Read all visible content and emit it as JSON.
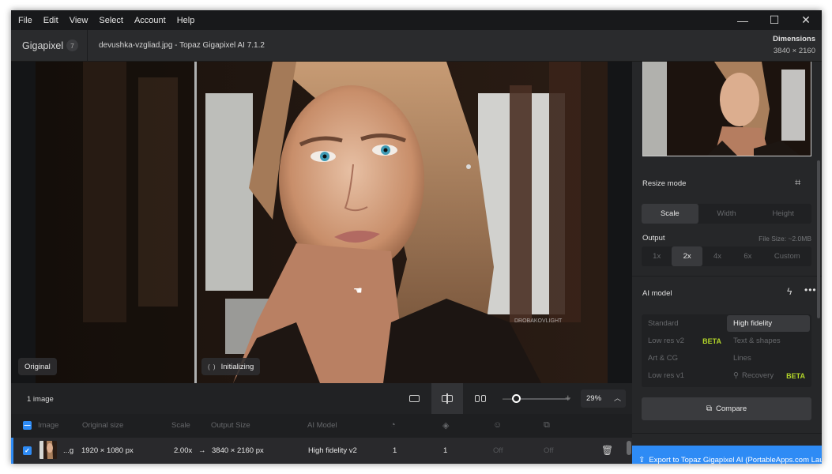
{
  "menu": [
    "File",
    "Edit",
    "View",
    "Select",
    "Account",
    "Help"
  ],
  "window_controls": {
    "minimize": "—",
    "maximize": "☐",
    "close": "✕"
  },
  "header": {
    "app_name": "Gigapixel",
    "app_count": "7",
    "doc_title": "devushka-vzgliad.jpg - Topaz Gigapixel AI 7.1.2",
    "dimensions_label": "Dimensions",
    "dimensions_value": "3840 × 2160"
  },
  "viewer": {
    "original_label": "Original",
    "initializing_label": "Initializing",
    "cursor_icon": "hand-icon"
  },
  "panel": {
    "resize_mode_label": "Resize mode",
    "resize_tabs": [
      "Scale",
      "Width",
      "Height"
    ],
    "resize_active": "Scale",
    "output_label": "Output",
    "file_size": "File Size: ~2.0MB",
    "output_options": [
      "1x",
      "2x",
      "4x",
      "6x",
      "Custom"
    ],
    "output_active": "2x",
    "ai_model_label": "AI model",
    "models": {
      "standard": "Standard",
      "high_fidelity": "High fidelity",
      "low_res_v2": "Low res v2",
      "text_shapes": "Text & shapes",
      "art_cg": "Art & CG",
      "lines": "Lines",
      "low_res_v1": "Low res v1",
      "recovery": "Recovery",
      "beta": "BETA"
    },
    "model_active": "High fidelity",
    "compare_label": "Compare",
    "export_label": "Export to Topaz Gigapixel AI (PortableApps.com Lau"
  },
  "controls": {
    "image_count": "1 image",
    "zoom_value": "29%",
    "zoom_fraction": 0.0
  },
  "table": {
    "columns": [
      "Image",
      "Original size",
      "Scale",
      "Output Size",
      "AI Model"
    ],
    "rows": [
      {
        "name": "...g",
        "original_size": "1920 × 1080 px",
        "scale": "2.00x",
        "arrow": "→",
        "output_size": "3840 × 2160 px",
        "ai_model": "High fidelity v2",
        "c1": "1",
        "c2": "1",
        "c3": "Off",
        "c4": "Off"
      }
    ]
  },
  "colors": {
    "accent": "#2e8bf5",
    "beta": "#b3d62a"
  }
}
